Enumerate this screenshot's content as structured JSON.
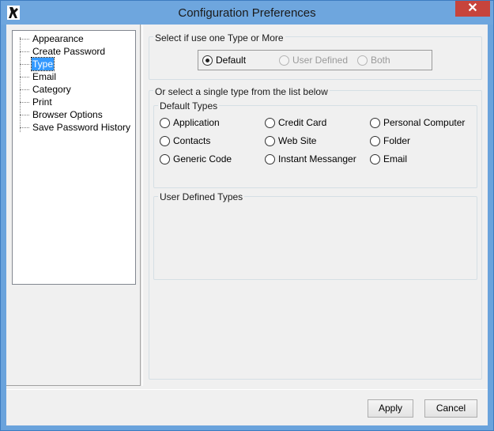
{
  "window": {
    "title": "Configuration Preferences",
    "close_label": "✕"
  },
  "tree": {
    "items": [
      {
        "label": "Appearance"
      },
      {
        "label": "Create Password"
      },
      {
        "label": "Type",
        "selected": true
      },
      {
        "label": "Email"
      },
      {
        "label": "Category"
      },
      {
        "label": "Print"
      },
      {
        "label": "Browser Options"
      },
      {
        "label": "Save Password History"
      }
    ]
  },
  "type_mode": {
    "heading": "Select if use one Type or More",
    "options": [
      {
        "label": "Default",
        "checked": true,
        "enabled": true
      },
      {
        "label": "User Defined",
        "checked": false,
        "enabled": false
      },
      {
        "label": "Both",
        "checked": false,
        "enabled": false
      }
    ]
  },
  "single_type": {
    "heading": "Or select a single type from the list below",
    "default_types_label": "Default Types",
    "default_types": [
      "Application",
      "Credit Card",
      "Personal Computer",
      "Contacts",
      "Web Site",
      "Folder",
      "Generic Code",
      "Instant Messanger",
      "Email"
    ],
    "user_defined_label": "User Defined Types"
  },
  "buttons": {
    "apply": "Apply",
    "cancel": "Cancel"
  },
  "colors": {
    "selection": "#3399ff",
    "title_bar": "#6ea6de",
    "close_button": "#c7443c"
  }
}
